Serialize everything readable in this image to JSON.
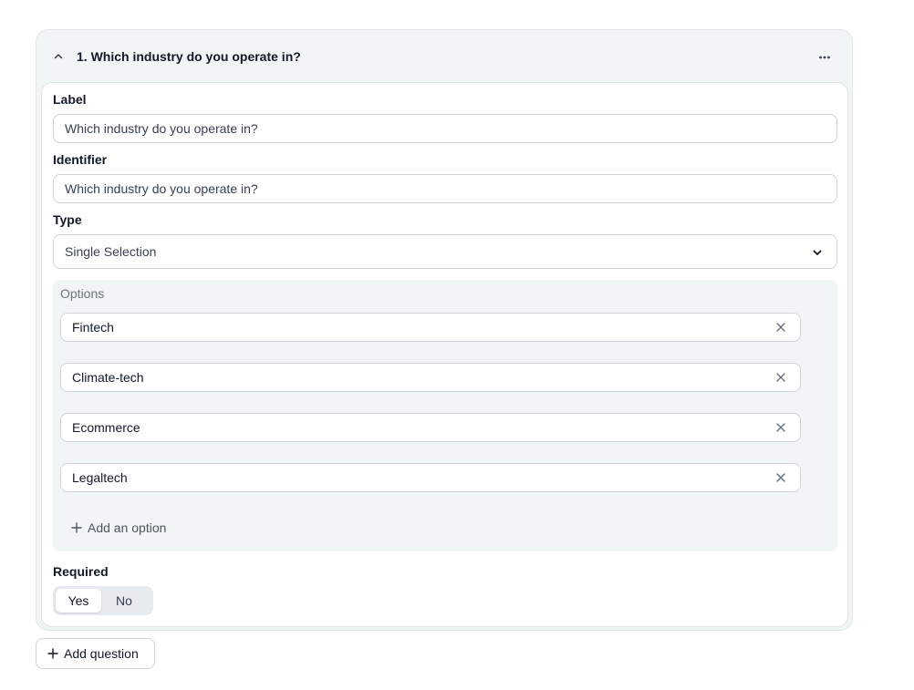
{
  "question": {
    "title": "1. Which industry do you operate in?",
    "label_title": "Label",
    "label_value": "Which industry do you operate in?",
    "identifier_title": "Identifier",
    "identifier_value": "Which industry do you operate in?",
    "type_title": "Type",
    "type_value": "Single Selection",
    "options_title": "Options",
    "options": [
      {
        "label": "Fintech"
      },
      {
        "label": "Climate-tech"
      },
      {
        "label": "Ecommerce"
      },
      {
        "label": "Legaltech"
      }
    ],
    "add_option_label": "Add an option",
    "required_title": "Required",
    "required_yes": "Yes",
    "required_no": "No",
    "required_selected": "Yes"
  },
  "actions": {
    "add_question_label": "Add question"
  },
  "icons": {
    "collapse": "chevron-up-icon",
    "more": "more-horizontal-icon",
    "select": "chevron-down-icon",
    "remove": "close-icon",
    "add": "plus-icon"
  },
  "colors": {
    "card_bg": "#f2f5f5",
    "text": "#111827",
    "muted": "#6b7280",
    "border": "#d1d5db"
  }
}
